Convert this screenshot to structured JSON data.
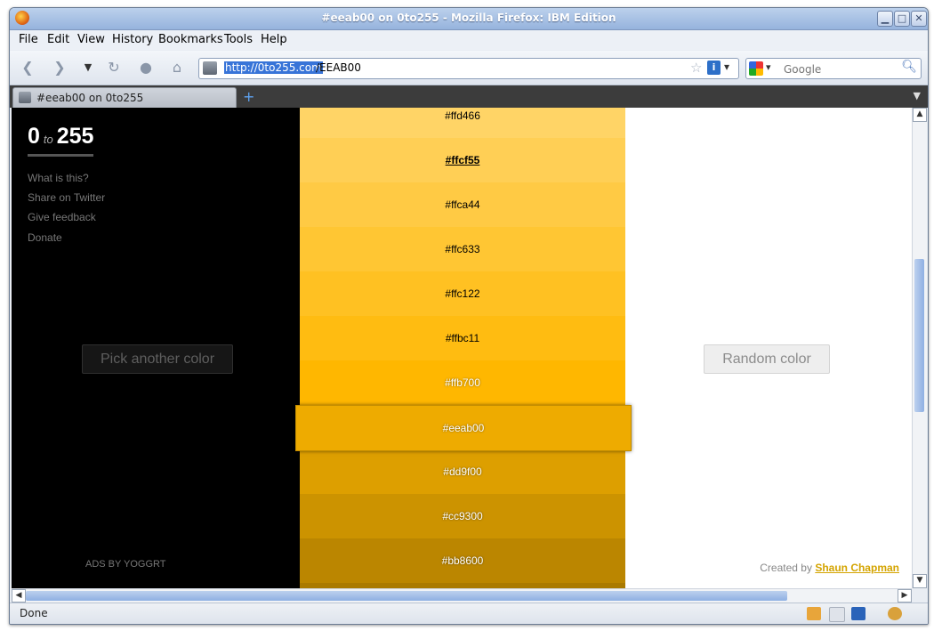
{
  "window": {
    "title": "#eeab00 on 0to255 - Mozilla Firefox: IBM Edition"
  },
  "menu": [
    "File",
    "Edit",
    "View",
    "History",
    "Bookmarks",
    "Tools",
    "Help"
  ],
  "nav": {
    "url_host": "http://0to255.com",
    "url_path": "/EEAB00",
    "search_placeholder": "Google"
  },
  "tab": {
    "label": "#eeab00 on 0to255",
    "new_tab_glyph": "+"
  },
  "site": {
    "logo_left": "0",
    "logo_to": "to",
    "logo_right": "255",
    "links": [
      "What is this?",
      "Share on Twitter",
      "Give feedback",
      "Donate"
    ],
    "pick_button": "Pick another color",
    "random_button": "Random color",
    "ads": "ADS BY YOGGRT",
    "credit_prefix": "Created by",
    "credit_name": "Shaun Chapman"
  },
  "swatches": [
    {
      "hex": "#ffd466",
      "bg": "#ffd466",
      "fg": "#000000"
    },
    {
      "hex": "#ffcf55",
      "bg": "#ffcf55",
      "fg": "#000000",
      "underlined": true
    },
    {
      "hex": "#ffca44",
      "bg": "#ffca44",
      "fg": "#000000"
    },
    {
      "hex": "#ffc633",
      "bg": "#ffc633",
      "fg": "#000000"
    },
    {
      "hex": "#ffc122",
      "bg": "#ffc122",
      "fg": "#000000"
    },
    {
      "hex": "#ffbc11",
      "bg": "#ffbc11",
      "fg": "#000000"
    },
    {
      "hex": "#ffb700",
      "bg": "#ffb700",
      "fg": "#ffffff"
    },
    {
      "hex": "#eeab00",
      "bg": "#eeab00",
      "fg": "#ffffff",
      "selected": true
    },
    {
      "hex": "#dd9f00",
      "bg": "#dd9f00",
      "fg": "#ffffff"
    },
    {
      "hex": "#cc9300",
      "bg": "#cc9300",
      "fg": "#ffffff"
    },
    {
      "hex": "#bb8600",
      "bg": "#bb8600",
      "fg": "#ffffff"
    },
    {
      "hex": "",
      "bg": "#aa7a00",
      "fg": "#ffffff"
    }
  ],
  "status": {
    "text": "Done"
  }
}
